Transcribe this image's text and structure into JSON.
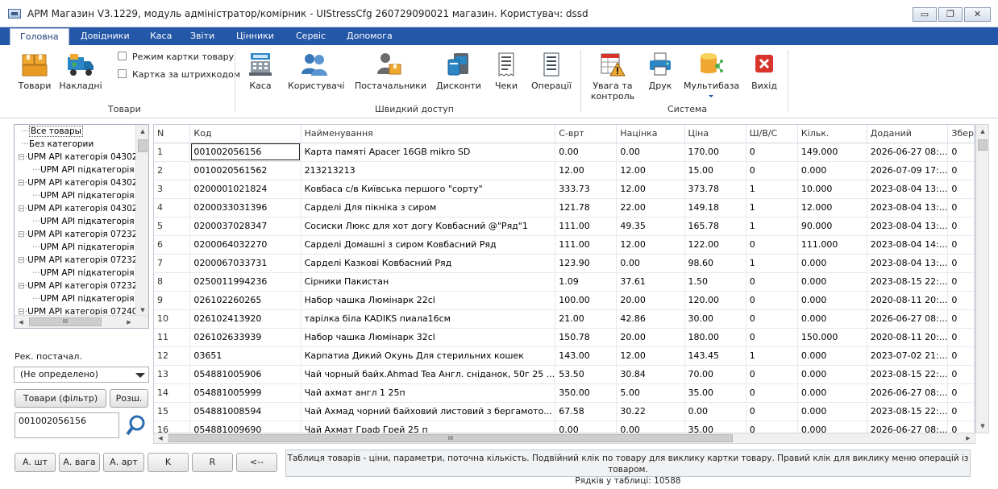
{
  "window": {
    "title": "АРМ Магазин V3.1229, модуль адміністратор/комірник - UIStressCfg 260729090021 магазин. Користувач: dssd",
    "min_label": "▭",
    "restore_label": "❐",
    "close_label": "✕"
  },
  "menu": [
    "Головна",
    "Довідники",
    "Каса",
    "Звіти",
    "Цінники",
    "Сервіс",
    "Допомога"
  ],
  "ribbon": {
    "goods_group": {
      "label": "Товари",
      "buttons": [
        "Товари",
        "Накладні"
      ],
      "checks": [
        "Режим картки товару",
        "Картка за штрихкодом"
      ]
    },
    "quick_group": {
      "label": "Швидкий доступ",
      "buttons": [
        "Каса",
        "Користувачі",
        "Постачальники",
        "Дисконти",
        "Чеки",
        "Операції"
      ]
    },
    "system_group": {
      "label": "Система",
      "buttons": [
        "Увага та\nконтроль",
        "Друк",
        "Мультибаза",
        "Вихід"
      ],
      "attention_line1": "Увага та",
      "attention_line2": "контроль"
    }
  },
  "tree": {
    "items": [
      "Все товары",
      "Без категории",
      "UPM API категорія 04302",
      "UPM API підкатегорія",
      "UPM API категорія 04302",
      "UPM API підкатегорія",
      "UPM API категорія 04302",
      "UPM API підкатегорія",
      "UPM API категорія 07232",
      "UPM API підкатегорія",
      "UPM API категорія 07232",
      "UPM API підкатегорія",
      "UPM API категорія 07232",
      "UPM API підкатегорія",
      "UPM API категорія 07240",
      "UPM API підкатегорія"
    ],
    "hscroll_label": "III"
  },
  "filters": {
    "supplier_label": "Рек. постачал.",
    "supplier_value": "(Не определено)",
    "goods_filter_button": "Товари (фільтр)",
    "expand_button": "Розш.",
    "search_value": "001002056156"
  },
  "grid": {
    "columns": [
      "N",
      "Код",
      "Найменування",
      "С-врт",
      "Націнка",
      "Ціна",
      "Ш/В/С",
      "Кільк.",
      "Доданий",
      "Збер"
    ],
    "rows": [
      [
        "1",
        "001002056156",
        "Карта памяті Apacer 16GB mikro SD",
        "0.00",
        "0.00",
        "170.00",
        "0",
        "149.000",
        "2026-06-27 08:...",
        "0"
      ],
      [
        "2",
        "0010020561562",
        "213213213",
        "12.00",
        "12.00",
        "15.00",
        "0",
        "0.000",
        "2026-07-09 17:...",
        "0"
      ],
      [
        "3",
        "0200001021824",
        "Ковбаса с/в Київська першого \"сорту\"",
        "333.73",
        "12.00",
        "373.78",
        "1",
        "10.000",
        "2023-08-04 13:...",
        "0"
      ],
      [
        "4",
        "0200033031396",
        "Сарделі Для пікніка з сиром",
        "121.78",
        "22.00",
        "149.18",
        "1",
        "12.000",
        "2023-08-04 13:...",
        "0"
      ],
      [
        "5",
        "0200037028347",
        "Сосиски Люкс для хот догу Ковбасний @\"Ряд\"1",
        "111.00",
        "49.35",
        "165.78",
        "1",
        "90.000",
        "2023-08-04 13:...",
        "0"
      ],
      [
        "6",
        "0200064032270",
        "Сарделі Домашні з сиром Ковбасний Ряд",
        "111.00",
        "12.00",
        "122.00",
        "0",
        "111.000",
        "2023-08-04 14:...",
        "0"
      ],
      [
        "7",
        "0200067033731",
        "Сарделі Казкові Ковбасний Ряд",
        "123.90",
        "0.00",
        "98.60",
        "1",
        "0.000",
        "2023-08-04 13:...",
        "0"
      ],
      [
        "8",
        "0250011994236",
        "Сірники Пакистан",
        "1.09",
        "37.61",
        "1.50",
        "0",
        "0.000",
        "2023-08-15 22:...",
        "0"
      ],
      [
        "9",
        "026102260265",
        "Набор чашка Люмінарк 22cl",
        "100.00",
        "20.00",
        "120.00",
        "0",
        "0.000",
        "2020-08-11 20:...",
        "0"
      ],
      [
        "10",
        "026102413920",
        "тарілка біла KADIKS пиала16см",
        "21.00",
        "42.86",
        "30.00",
        "0",
        "0.000",
        "2026-06-27 08:...",
        "0"
      ],
      [
        "11",
        "026102633939",
        "Набор чашка Люмінарк 32cl",
        "150.78",
        "20.00",
        "180.00",
        "0",
        "150.000",
        "2020-08-11 20:...",
        "0"
      ],
      [
        "12",
        "03651",
        "Карпатиа Дикий Окунь Для стерильних кошек",
        "143.00",
        "12.00",
        "143.45",
        "1",
        "0.000",
        "2023-07-02 21:...",
        "0"
      ],
      [
        "13",
        "054881005906",
        "Чай чорный байх.Ahmad Tea Англ. сніданок, 50г 25 ...",
        "53.50",
        "30.84",
        "70.00",
        "0",
        "0.000",
        "2023-08-15 22:...",
        "0"
      ],
      [
        "14",
        "054881005999",
        "Чай ахмат англ 1 25п",
        "350.00",
        "5.00",
        "35.00",
        "0",
        "0.000",
        "2026-06-27 08:...",
        "0"
      ],
      [
        "15",
        "054881008594",
        "Чай Ахмад чорний байховий листовий з бергамото...",
        "67.58",
        "30.22",
        "0.00",
        "0",
        "0.000",
        "2023-08-15 22:...",
        "0"
      ],
      [
        "16",
        "054881009690",
        "Чай Ахмат Граф Грей 25 п",
        "0.00",
        "0.00",
        "35.00",
        "0",
        "0.000",
        "2026-06-27 08:...",
        "0"
      ]
    ],
    "hscroll_label": "III"
  },
  "bottom": {
    "buttons": [
      "А. шт",
      "А. вага",
      "А. арт",
      "K",
      "R",
      "<--"
    ],
    "status_line1": "Таблиця товарів - ціни, параметри, поточна кількість. Подвійний клік по товару для виклику картки товару. Правий клік для виклику меню операцій із товаром.",
    "status_line2": "Рядків у таблиці: 10588"
  },
  "colors": {
    "menu_bg": "#2457a7",
    "accent_red": "#d9342b",
    "folder_orange": "#f0a830"
  }
}
